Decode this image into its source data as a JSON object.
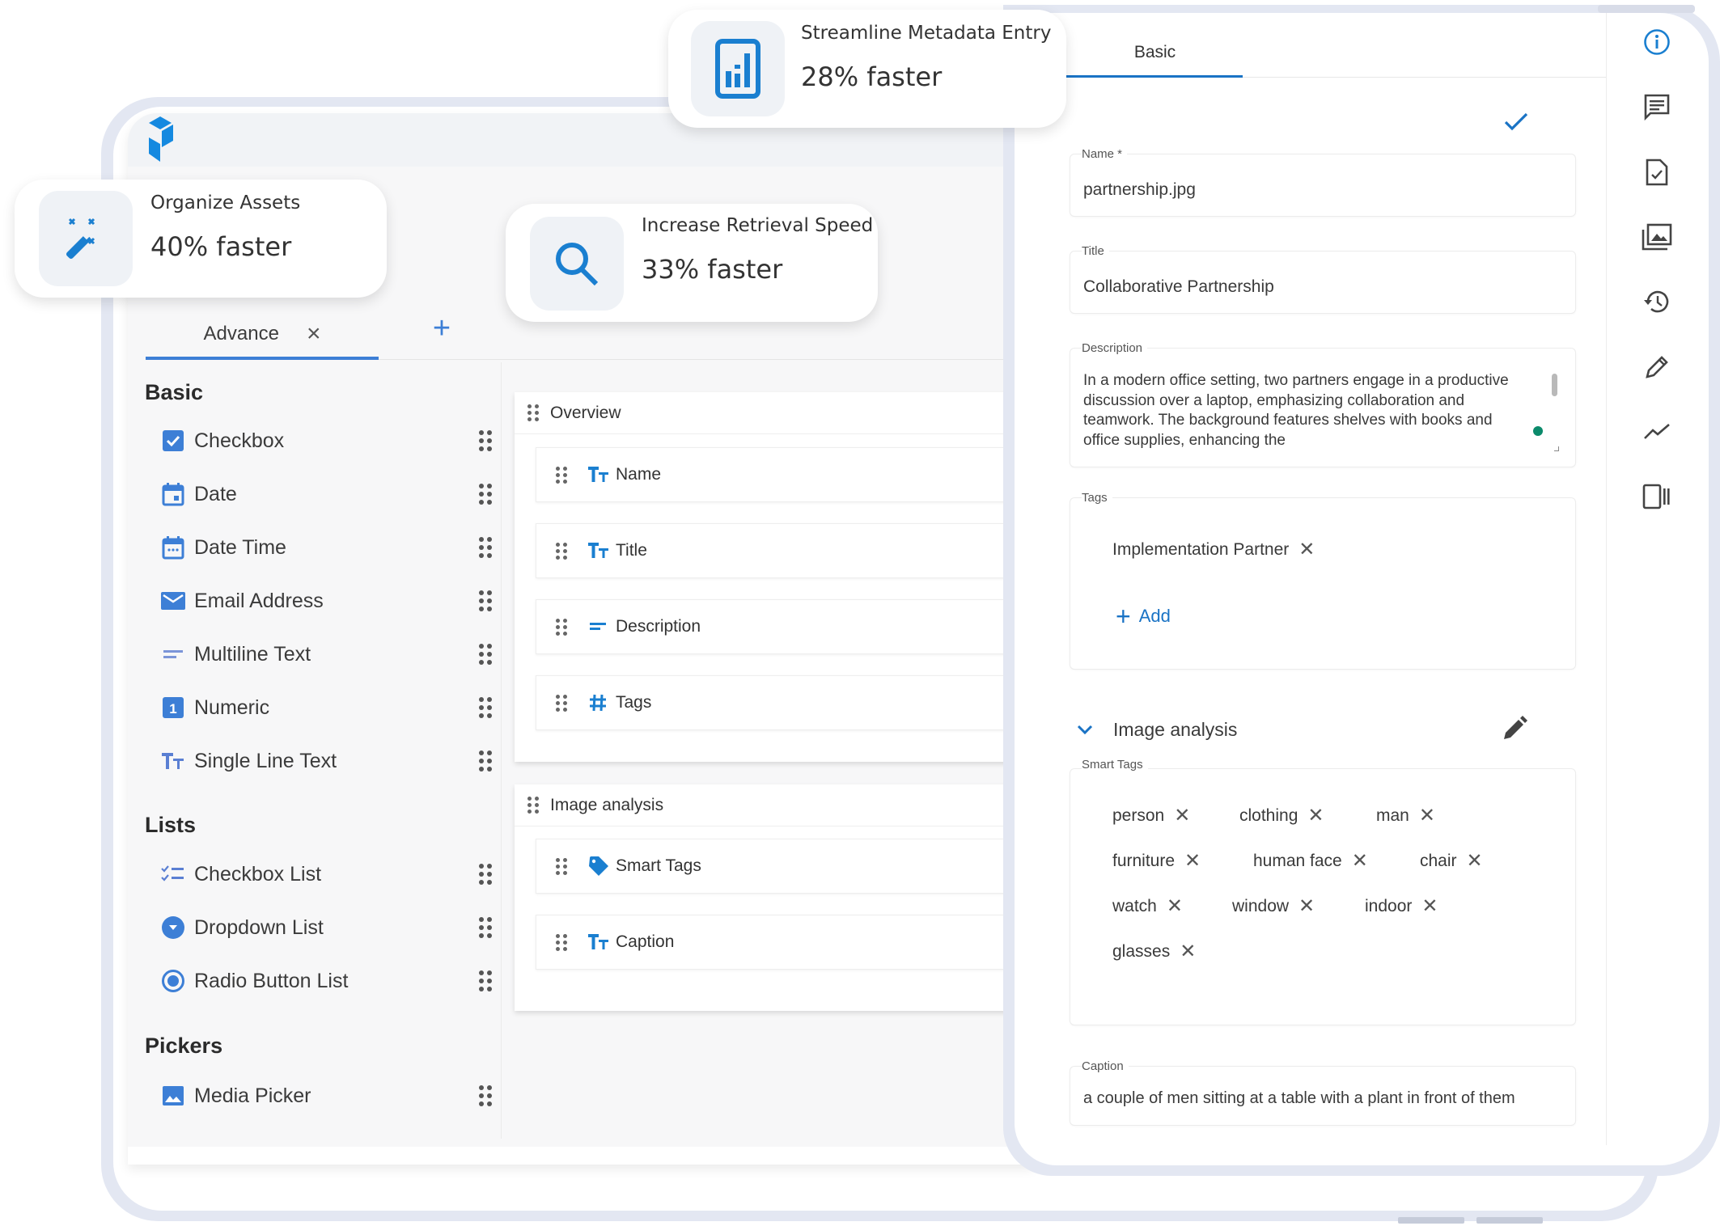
{
  "stats": [
    {
      "title": "Organize Assets",
      "value": "40% faster",
      "icon": "magic-wand-icon"
    },
    {
      "title": "Increase Retrieval Speed",
      "value": "33% faster",
      "icon": "search-icon"
    },
    {
      "title": "Streamline Metadata Entry",
      "value": "28% faster",
      "icon": "bar-chart-icon"
    }
  ],
  "colors": {
    "accent": "#1a7fd0",
    "tab_underline": "#3d7fd6",
    "frame": "#e3e7f2",
    "status_dot": "#0b8a6b"
  },
  "builder": {
    "tab": {
      "label": "Advance",
      "close": "×",
      "add": "+"
    },
    "sections": [
      {
        "title": "Basic",
        "items": [
          {
            "label": "Checkbox",
            "icon": "checkbox-icon"
          },
          {
            "label": "Date",
            "icon": "calendar-icon"
          },
          {
            "label": "Date Time",
            "icon": "calendar-time-icon"
          },
          {
            "label": "Email Address",
            "icon": "email-icon"
          },
          {
            "label": "Multiline Text",
            "icon": "multiline-text-icon"
          },
          {
            "label": "Numeric",
            "icon": "numeric-icon"
          },
          {
            "label": "Single Line Text",
            "icon": "text-icon"
          }
        ]
      },
      {
        "title": "Lists",
        "items": [
          {
            "label": "Checkbox List",
            "icon": "checklist-icon"
          },
          {
            "label": "Dropdown List",
            "icon": "dropdown-icon"
          },
          {
            "label": "Radio Button List",
            "icon": "radio-icon"
          }
        ]
      },
      {
        "title": "Pickers",
        "items": [
          {
            "label": "Media Picker",
            "icon": "image-icon"
          }
        ]
      }
    ],
    "groups": [
      {
        "title": "Overview",
        "fields": [
          {
            "label": "Name",
            "icon": "text-icon"
          },
          {
            "label": "Title",
            "icon": "text-icon"
          },
          {
            "label": "Description",
            "icon": "multiline-text-icon"
          },
          {
            "label": "Tags",
            "icon": "hash-icon"
          }
        ]
      },
      {
        "title": "Image analysis",
        "fields": [
          {
            "label": "Smart Tags",
            "icon": "tag-icon"
          },
          {
            "label": "Caption",
            "icon": "text-icon"
          }
        ]
      }
    ]
  },
  "details": {
    "tab": "Basic",
    "fields": {
      "name": {
        "label": "Name *",
        "value": "partnership.jpg"
      },
      "title": {
        "label": "Title",
        "value": "Collaborative Partnership"
      },
      "description": {
        "label": "Description",
        "value": "In a modern office setting, two partners engage in a productive discussion over a laptop, emphasizing collaboration and teamwork. The background features shelves with books and office supplies, enhancing the"
      },
      "tags": {
        "label": "Tags",
        "chips": [
          "Implementation Partner"
        ],
        "add_label": "Add"
      }
    },
    "image_analysis": {
      "title": "Image analysis",
      "smart_tags_label": "Smart Tags",
      "smart_tags": [
        "person",
        "clothing",
        "man",
        "furniture",
        "human face",
        "chair",
        "watch",
        "window",
        "indoor",
        "glasses"
      ],
      "caption_label": "Caption",
      "caption": "a couple of men sitting at a table with a plant in front of them"
    },
    "side_icons": [
      "info-icon",
      "comment-icon",
      "file-check-icon",
      "image-library-icon",
      "history-icon",
      "pencil-icon",
      "trend-icon",
      "panel-toggle-icon"
    ]
  }
}
